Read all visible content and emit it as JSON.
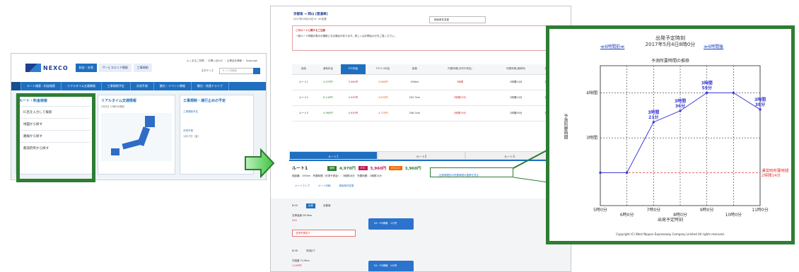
{
  "screenshot1": {
    "logo_text": "NEXCO",
    "top_nav": [
      "料金・渋滞",
      "サービスエリア情報",
      "工事規制"
    ],
    "user_links": "よくあるご質問 ｜ お問い合わせ ｜ 企業会社情報 ｜ language",
    "font_size_label": "文字サイズ",
    "search_placeholder": "サイト内検索",
    "nav2": [
      "ルート検索・料金検索",
      "リアルタイム交通情報",
      "工事規制予定",
      "渋滞予測",
      "観光・イベント情報",
      "観光・快適ドライブ"
    ],
    "card1": {
      "title": "ルート・料金検索",
      "items": [
        "IC名を入力して検索",
        "地図から探す",
        "路線から探す",
        "都道府県から探す"
      ]
    },
    "card2": {
      "title": "リアルタイム交通情報",
      "note": "2月5日 12時5分現在"
    },
    "card3": {
      "title": "工事規制・通行止めの予定",
      "item1": "工事規制予定",
      "item2": "渋滞予測",
      "item2_note": "1月27日（金）"
    }
  },
  "screenshot2": {
    "route": "京都南 → 岡山 [普通車]",
    "date": "2017年05月04日 8：00出発",
    "button": "検索条件変更",
    "alert_title": "このルートに関するご注意",
    "alert_body": "一部ルート時間の表示が通常になる場合があります。詳しくはお問合わせをご覧ください。",
    "table_headers": [
      "経路",
      "通常料金",
      "ETC料金",
      "ETC2.0料金",
      "距離",
      "所要時間(渋滞予測含)",
      "所要時間(通常時)",
      "詳細"
    ],
    "table_rows": [
      [
        "ルート1",
        "4,970円",
        "3,960円",
        "3,960円",
        "195km",
        "3時間",
        "2時間14分",
        "詳細"
      ],
      [
        "ルート2",
        "6,140円",
        "4,930円",
        "4,930円",
        "202.7km",
        "3時間20分",
        "2時間14分",
        "詳細"
      ],
      [
        "ルート3",
        "5,960円",
        "4,930円",
        "4,720円",
        "206.7km",
        "3時間19分",
        "2時間45分",
        "詳細"
      ]
    ],
    "tabs": [
      "ルート1",
      "ルート2",
      "ルート3"
    ],
    "r1_title": "ルート1",
    "r1_normal_tag": "通常",
    "r1_normal": "4,970円",
    "r1_etc_tag": "ETC",
    "r1_etc": "3,960円",
    "r1_etc2_tag": "ETC2.0",
    "r1_etc2": "3,960円",
    "r1_info": "総距離：195km　所要時間（渋滞予測含）：3時間18分　所要時間：2時間14分",
    "r1_link": "出発時間別の所要時間の推移を見る",
    "actions": [
      "ルートマップ",
      "ルート印刷",
      "検索条件変更"
    ],
    "timeline": [
      {
        "time": "8:00",
        "tag": "出発",
        "place": "京都南"
      },
      {
        "place": "名神高速 26.9km",
        "sub": "250"
      },
      {
        "warn": "渋滞予測あり"
      },
      {
        "sa": "SA・PA情報　1か所"
      },
      {
        "time": "8:28",
        "place": "吹田JCT"
      },
      {
        "place": "中国道 71.9km",
        "sub": "1,090円"
      },
      {
        "sa": "SA・PA情報　2か所"
      }
    ]
  },
  "popup": {
    "title": "出発予定時刻",
    "date": "2017年5月4日8時0分",
    "prev": "≪6時間前≪",
    "next": "≫6時間後",
    "chart_title": "予測所要時間の推移",
    "ylabel": "予測所要時間",
    "xlabel": "出発予定時刻",
    "copyright": "Copyright (C) West Nippon Expressway Company Limited All rights reserved."
  },
  "chart_data": {
    "type": "line",
    "title": "予測所要時間の推移",
    "xlabel": "出発予定時刻",
    "ylabel": "予測所要時間",
    "x_ticks": [
      "5時0分",
      "6時0分",
      "7時0分",
      "8時0分",
      "9時0分",
      "10時0分",
      "11時0分"
    ],
    "y_ticks": [
      "3時間",
      "4時間"
    ],
    "x": [
      5.0,
      6.0,
      7.0,
      8.0,
      9.0,
      10.0,
      11.0
    ],
    "y": [
      2.23,
      2.23,
      3.35,
      3.6,
      4.0,
      4.0,
      3.63
    ],
    "point_labels": [
      "",
      "",
      "3時間\n21分",
      "3時間\n36分",
      "3時間\n59分",
      "",
      "3時間\n38分"
    ],
    "reference_line": {
      "y": 2.23,
      "label": "通常時所要時間\n2時間14分",
      "color": "#e53935"
    },
    "xlim": [
      5,
      11
    ],
    "ylim": [
      1.5,
      4.6
    ],
    "line_color": "#3a3ad8"
  }
}
